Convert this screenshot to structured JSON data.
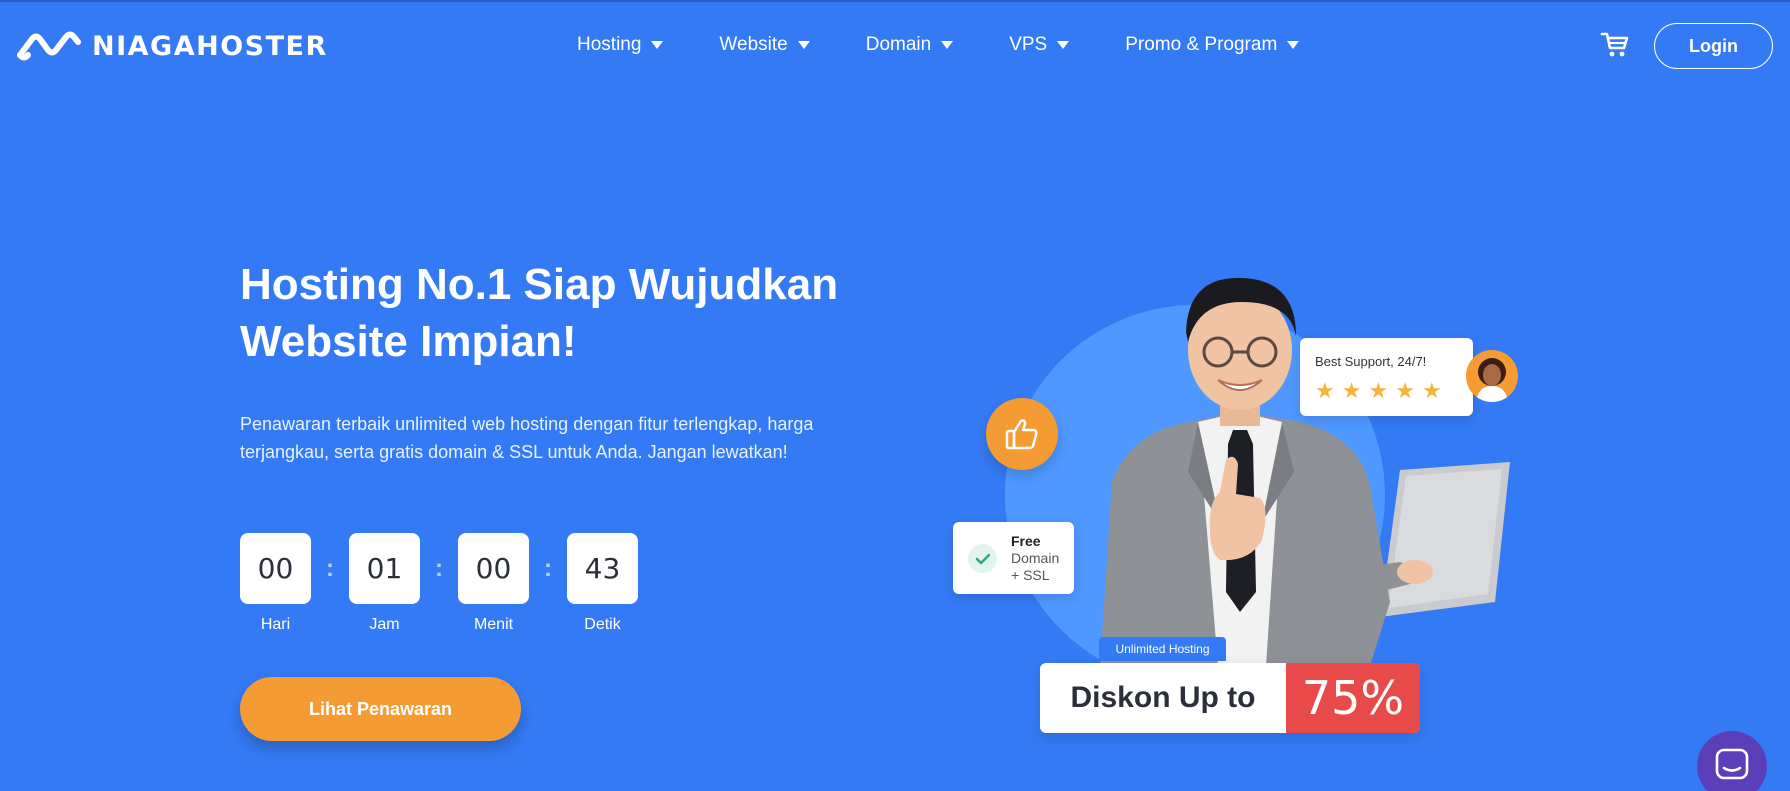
{
  "brand": {
    "name": "NIAGAHOSTER"
  },
  "nav": {
    "items": [
      {
        "label": "Hosting"
      },
      {
        "label": "Website"
      },
      {
        "label": "Domain"
      },
      {
        "label": "VPS"
      },
      {
        "label": "Promo & Program"
      }
    ],
    "cart_icon": "cart-icon",
    "login_label": "Login"
  },
  "hero": {
    "title_line1": "Hosting No.1 Siap Wujudkan",
    "title_line2": "Website Impian!",
    "subtitle_line1": "Penawaran terbaik unlimited web hosting dengan fitur terlengkap, harga",
    "subtitle_line2": "terjangkau, serta gratis domain & SSL untuk Anda. Jangan lewatkan!",
    "countdown": [
      {
        "value": "00",
        "label": "Hari"
      },
      {
        "value": "01",
        "label": "Jam"
      },
      {
        "value": "00",
        "label": "Menit"
      },
      {
        "value": "43",
        "label": "Detik"
      }
    ],
    "separator": ":",
    "cta_label": "Lihat Penawaran"
  },
  "illustration": {
    "support_text": "Best Support, 24/7!",
    "rating_stars": 5,
    "free_title": "Free",
    "free_line1": "Domain",
    "free_line2": "+ SSL",
    "tag": "Unlimited Hosting",
    "diskon_label": "Diskon Up to",
    "diskon_value": "75%"
  },
  "colors": {
    "background": "#347af4",
    "accent": "#f49c33",
    "discount_red": "#e84a4a",
    "chat_purple": "#5b3fb8"
  }
}
